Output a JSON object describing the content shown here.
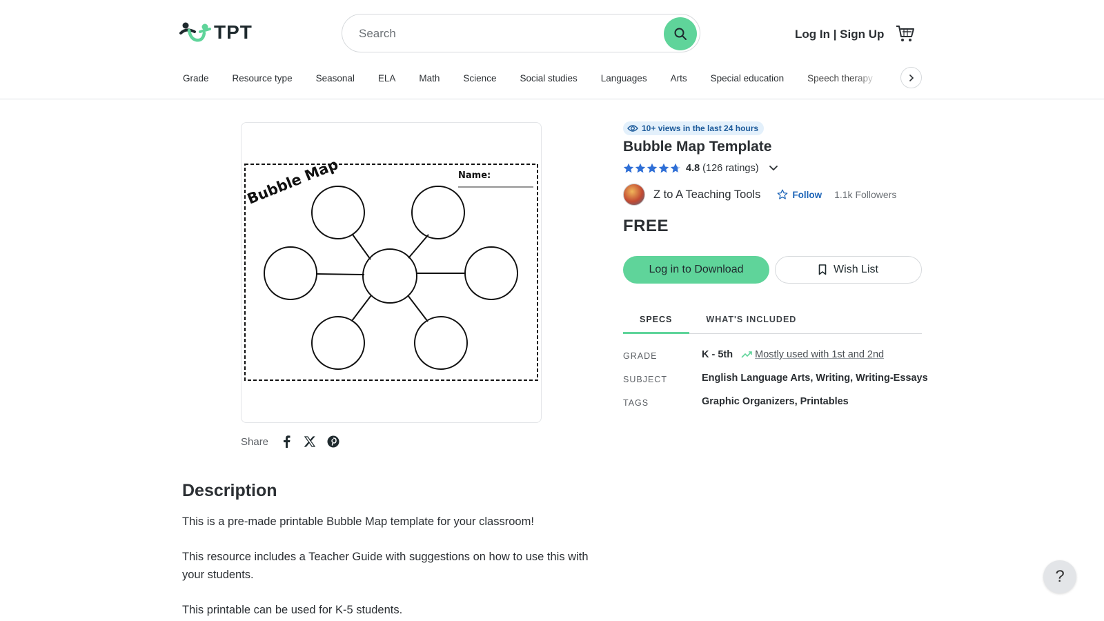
{
  "header": {
    "logo_text": "TPT",
    "search_placeholder": "Search",
    "login_label": "Log In | Sign Up"
  },
  "nav": {
    "items": [
      "Grade",
      "Resource type",
      "Seasonal",
      "ELA",
      "Math",
      "Science",
      "Social studies",
      "Languages",
      "Arts",
      "Special education",
      "Speech therapy"
    ]
  },
  "preview": {
    "heading": "Bubble Map",
    "name_label": "Name:"
  },
  "share": {
    "label": "Share"
  },
  "product": {
    "views_badge": "10+ views in the last 24 hours",
    "title": "Bubble Map Template",
    "rating_value": "4.8",
    "rating_count": "(126 ratings)",
    "seller_name": "Z to A Teaching Tools",
    "follow_label": "Follow",
    "followers": "1.1k Followers",
    "price": "FREE",
    "download_label": "Log in to Download",
    "wishlist_label": "Wish List"
  },
  "tabs": [
    "SPECS",
    "WHAT'S INCLUDED"
  ],
  "specs": {
    "grade_label": "GRADE",
    "grade_value": "K - 5th",
    "grade_note": "Mostly used with 1st and 2nd",
    "subject_label": "SUBJECT",
    "subject_value": "English Language Arts, Writing, Writing-Essays",
    "tags_label": "TAGS",
    "tags_value": "Graphic Organizers, Printables"
  },
  "description": {
    "title": "Description",
    "p1": "This is a pre-made printable Bubble Map template for your classroom!",
    "p2": "This resource includes a Teacher Guide with suggestions on how to use this with your students.",
    "p3": "This printable can be used for K-5 students."
  },
  "help": {
    "label": "?"
  },
  "colors": {
    "accent_green": "#5fd49a",
    "link_blue": "#1f66b8",
    "star_blue": "#2f6fd6"
  }
}
